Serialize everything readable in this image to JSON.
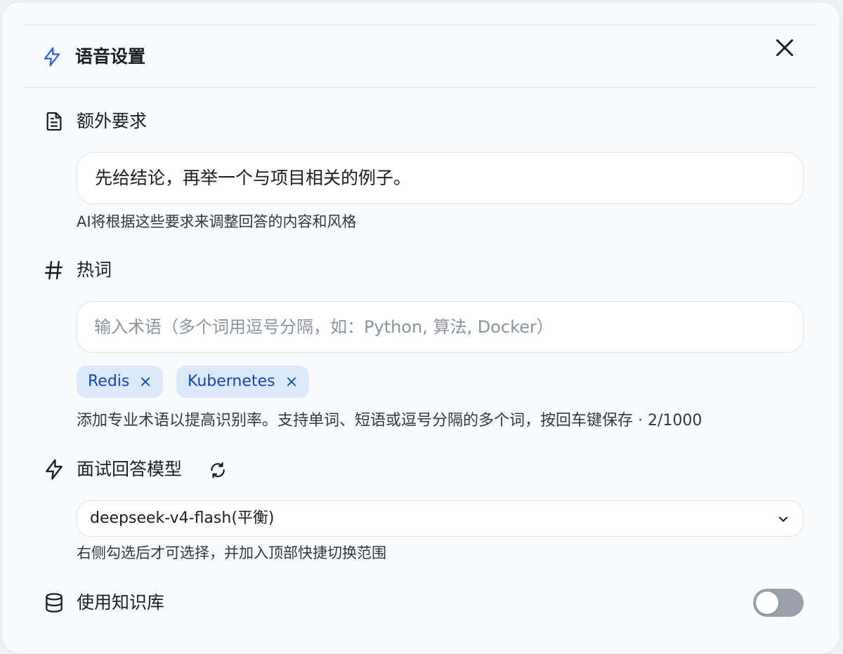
{
  "header": {
    "title": "语音设置"
  },
  "extra_requirements": {
    "label": "额外要求",
    "value": "先给结论，再举一个与项目相关的例子。",
    "hint": "AI将根据这些要求来调整回答的内容和风格"
  },
  "hotwords": {
    "label": "热词",
    "placeholder": "输入术语（多个词用逗号分隔，如：Python, 算法, Docker）",
    "tags": [
      {
        "label": "Redis"
      },
      {
        "label": "Kubernetes"
      }
    ],
    "hint": "添加专业术语以提高识别率。支持单词、短语或逗号分隔的多个词，按回车键保存 · 2/1000"
  },
  "model": {
    "label": "面试回答模型",
    "selected": "deepseek-v4-flash(平衡)",
    "hint": "右侧勾选后才可选择，并加入顶部快捷切换范围"
  },
  "knowledge_base": {
    "label": "使用知识库",
    "enabled": false
  },
  "colors": {
    "accent": "#2563eb",
    "tag_bg": "#dbe9fb",
    "tag_text": "#1546b8",
    "toggle_off": "#9aa0a9"
  },
  "icons": {
    "title": "lightning-icon",
    "close": "close-icon",
    "extra_requirements": "document-icon",
    "hotwords": "hash-icon",
    "model": "lightning-icon",
    "refresh": "refresh-icon",
    "select": "chevron-down-icon",
    "knowledge_base": "database-icon"
  }
}
